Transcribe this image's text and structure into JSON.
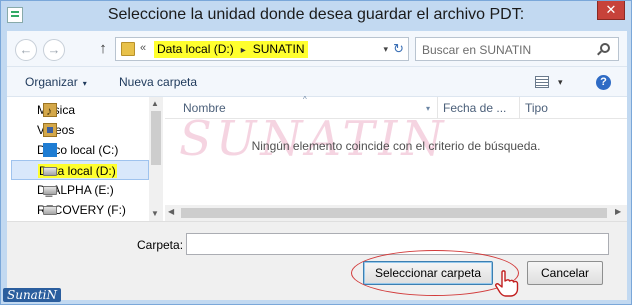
{
  "window": {
    "title": "Seleccione la unidad donde desea guardar el archivo PDT:",
    "close_glyph": "✕"
  },
  "nav": {
    "back_glyph": "←",
    "forward_glyph": "→",
    "up_glyph": "↑"
  },
  "address": {
    "prefix": "«",
    "crumbs": [
      "Data local (D:)",
      "SUNATIN"
    ],
    "separator_glyph": "▸",
    "drop_glyph": "▾",
    "refresh_glyph": "↻"
  },
  "search": {
    "placeholder": "Buscar en SUNATIN"
  },
  "toolbar": {
    "organize_label": "Organizar",
    "new_folder_label": "Nueva carpeta",
    "caret": "▾",
    "help_glyph": "?"
  },
  "tree": {
    "items": [
      {
        "label": "Música",
        "icon": "music-folder-icon"
      },
      {
        "label": "Vídeos",
        "icon": "video-folder-icon"
      },
      {
        "label": "Disco local (C:)",
        "icon": "windows-drive-icon"
      },
      {
        "label": "Data local (D:)",
        "icon": "drive-icon",
        "selected": true
      },
      {
        "label": "D_ALPHA (E:)",
        "icon": "drive-icon"
      },
      {
        "label": "RECOVERY (F:)",
        "icon": "drive-icon"
      }
    ]
  },
  "columns": {
    "name": "Nombre",
    "date": "Fecha de ...",
    "type": "Tipo",
    "sort_glyph": "^"
  },
  "content": {
    "empty_message": "Ningún elemento coincide con el criterio de búsqueda.",
    "watermark": "SUNATIN"
  },
  "scroll": {
    "up": "▲",
    "down": "▼",
    "left": "◀",
    "right": "▶"
  },
  "bottom": {
    "folder_label": "Carpeta:",
    "folder_value": "",
    "select_button": "Seleccionar carpeta",
    "cancel_button": "Cancelar"
  },
  "brand": {
    "text": "SunatiN"
  },
  "colors": {
    "highlight": "#ffff2e",
    "annotation": "#d23a3a",
    "accent": "#2e6bc5"
  }
}
